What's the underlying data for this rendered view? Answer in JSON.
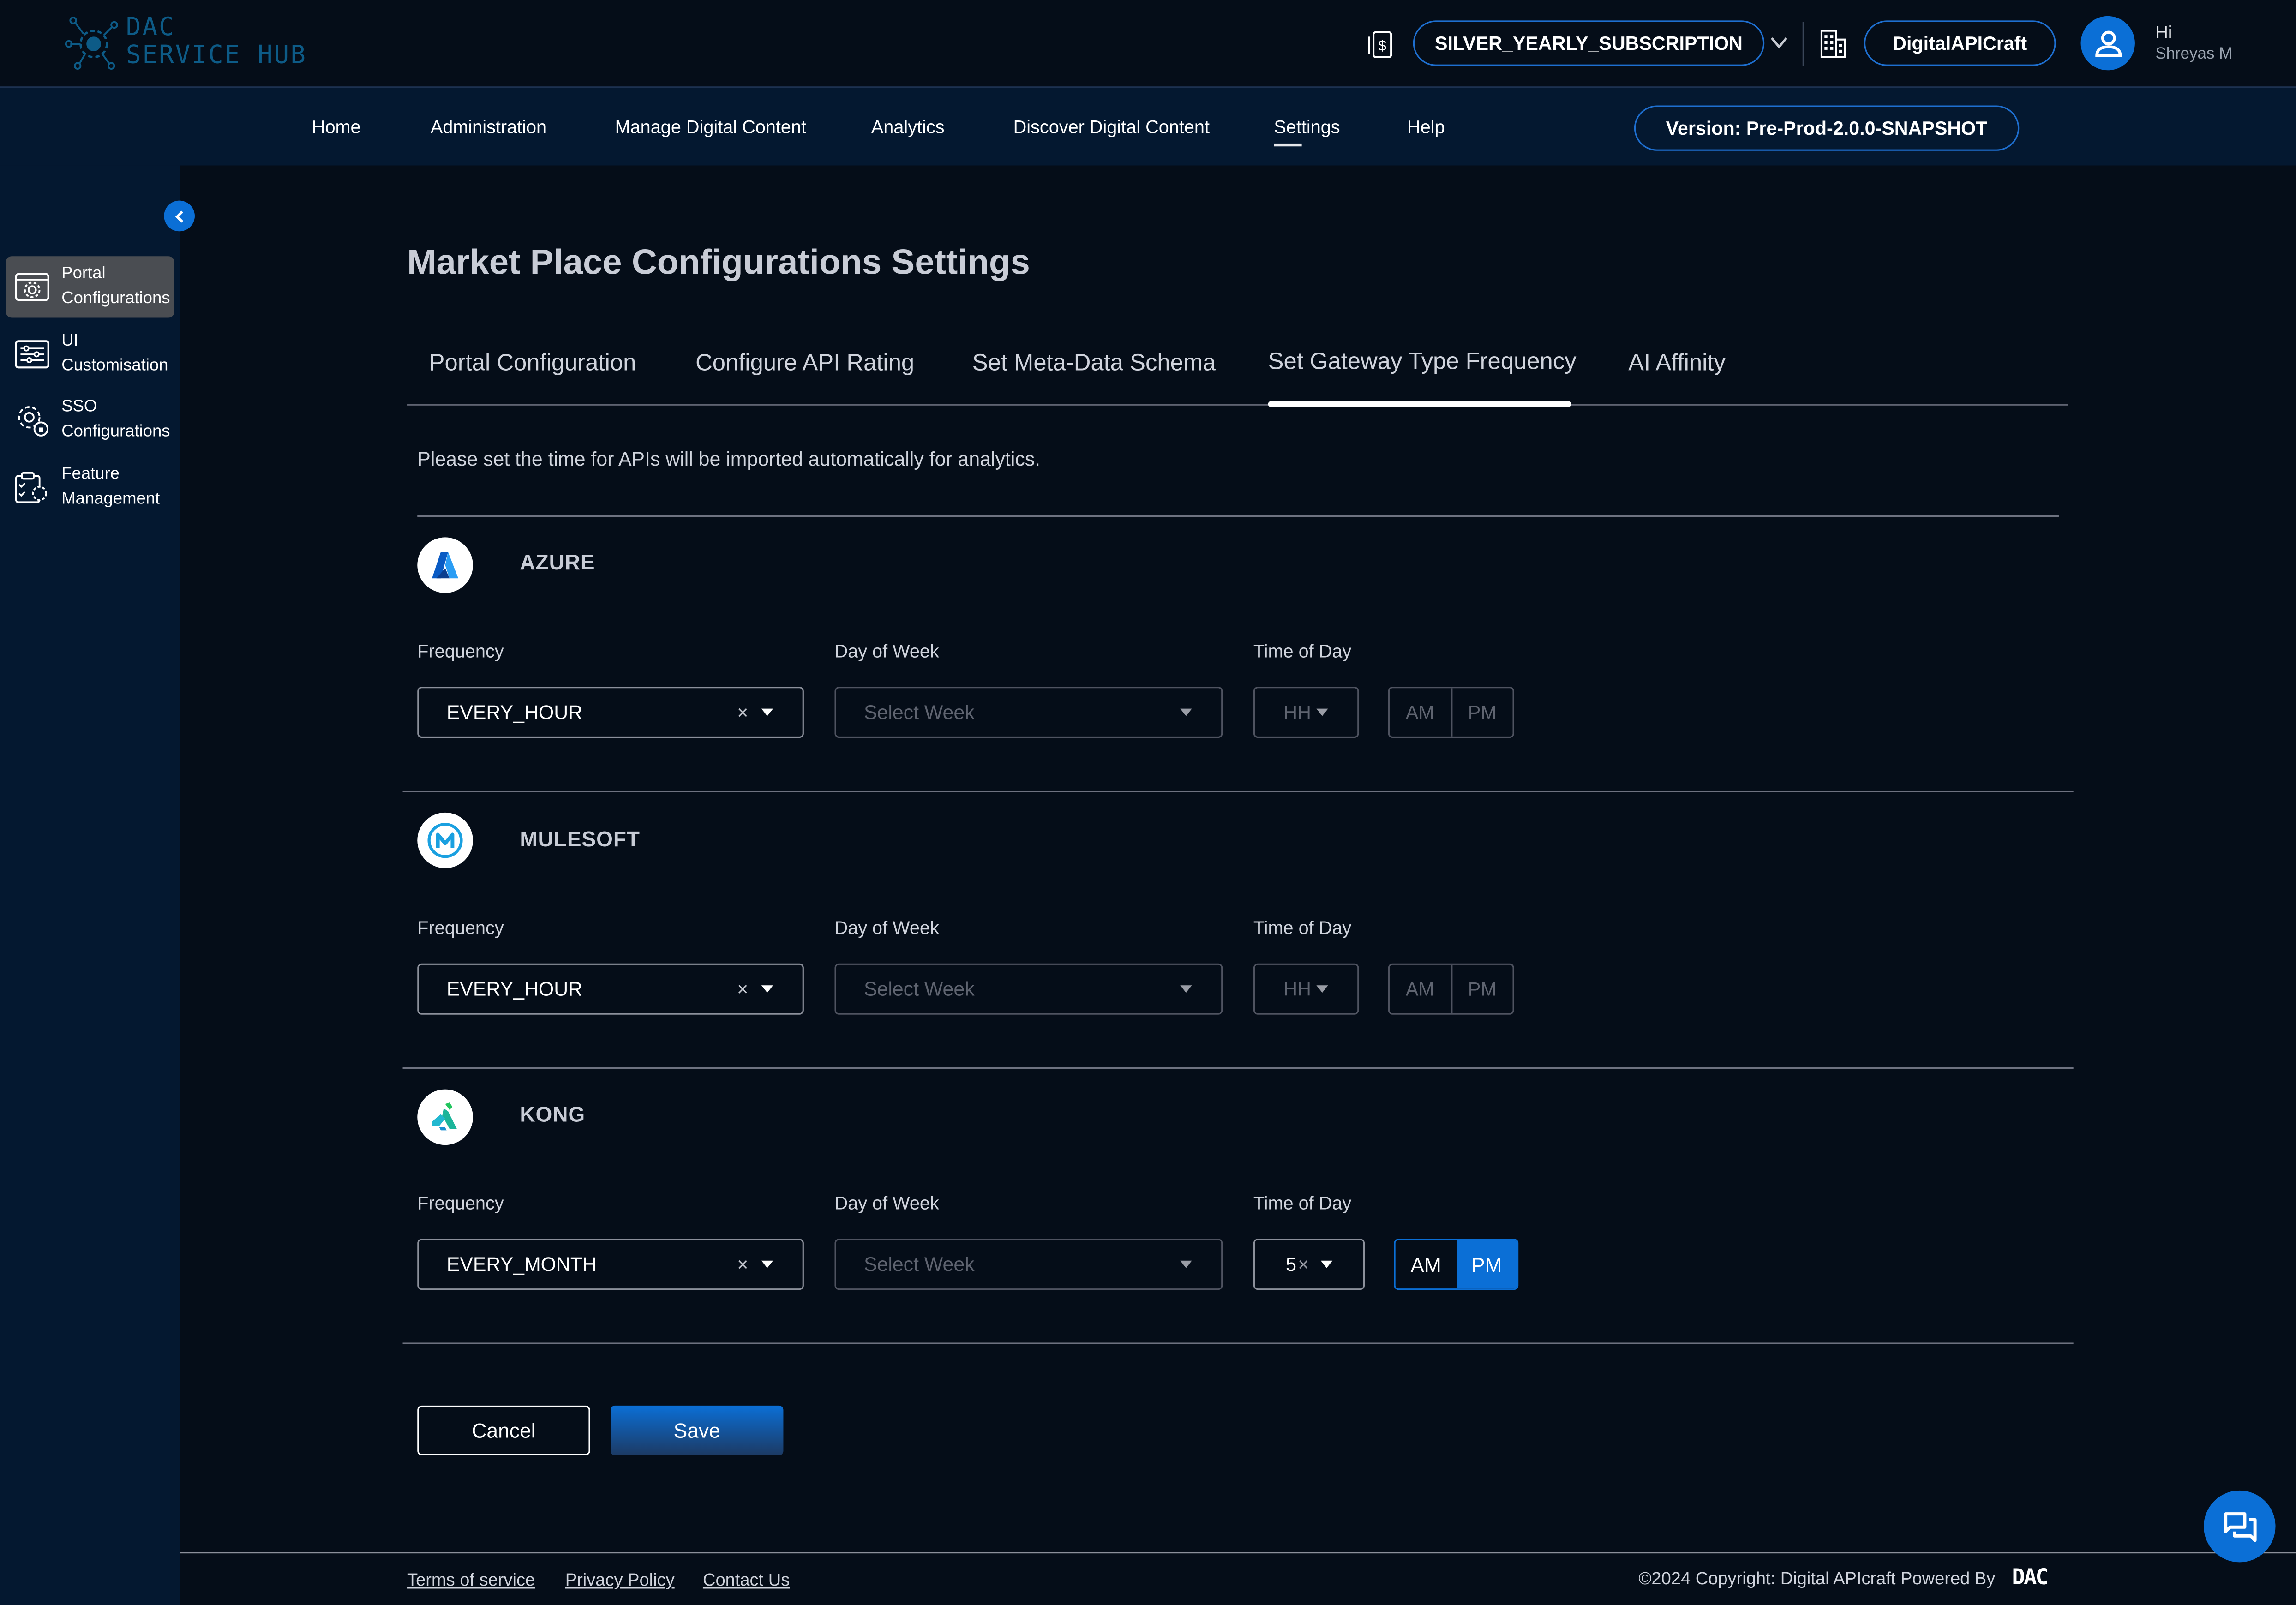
{
  "header": {
    "logo_line1": "DAC",
    "logo_line2": "SERVICE HUB",
    "subscription": "SILVER_YEARLY_SUBSCRIPTION",
    "organization": "DigitalAPICraft",
    "greeting": "Hi",
    "user_name": "Shreyas M"
  },
  "nav": {
    "items": [
      "Home",
      "Administration",
      "Manage Digital Content",
      "Analytics",
      "Discover Digital Content",
      "Settings",
      "Help"
    ],
    "active": "Settings",
    "version": "Version: Pre-Prod-2.0.0-SNAPSHOT"
  },
  "sidebar": {
    "items": [
      {
        "label_1": "Portal",
        "label_2": "Configurations",
        "icon": "portal-config-icon",
        "active": true
      },
      {
        "label_1": "UI",
        "label_2": "Customisation",
        "icon": "sliders-icon",
        "active": false
      },
      {
        "label_1": "SSO",
        "label_2": "Configurations",
        "icon": "gear-lock-icon",
        "active": false
      },
      {
        "label_1": "Feature",
        "label_2": "Management",
        "icon": "clipboard-gear-icon",
        "active": false
      }
    ]
  },
  "page": {
    "title": "Market Place Configurations Settings",
    "tabs": [
      "Portal Configuration",
      "Configure API Rating",
      "Set Meta-Data Schema",
      "Set Gateway Type Frequency",
      "AI Affinity"
    ],
    "active_tab": "Set Gateway Type Frequency",
    "description": "Please set the time for APIs will be imported automatically for analytics."
  },
  "labels": {
    "frequency": "Frequency",
    "day_of_week": "Day of Week",
    "time_of_day": "Time of Day",
    "am": "AM",
    "pm": "PM",
    "clear": "×"
  },
  "gateways": [
    {
      "name": "AZURE",
      "frequency": "EVERY_HOUR",
      "day_placeholder": "Select Week",
      "hour": "HH",
      "hour_set": false,
      "meridiem": null
    },
    {
      "name": "MULESOFT",
      "frequency": "EVERY_HOUR",
      "day_placeholder": "Select Week",
      "hour": "HH",
      "hour_set": false,
      "meridiem": null
    },
    {
      "name": "KONG",
      "frequency": "EVERY_MONTH",
      "day_placeholder": "Select Week",
      "hour": "5",
      "hour_clear": "×",
      "hour_set": true,
      "meridiem": "PM"
    }
  ],
  "actions": {
    "cancel": "Cancel",
    "save": "Save"
  },
  "footer": {
    "links": [
      "Terms of service",
      "Privacy Policy",
      "Contact Us"
    ],
    "copyright": "©2024 Copyright: Digital APIcraft Powered By",
    "brand": "DAC"
  },
  "colors": {
    "accent": "#0b6fd6",
    "background": "#050d18",
    "nav_bg": "#041830",
    "sidebar_active": "#4a4d52"
  }
}
